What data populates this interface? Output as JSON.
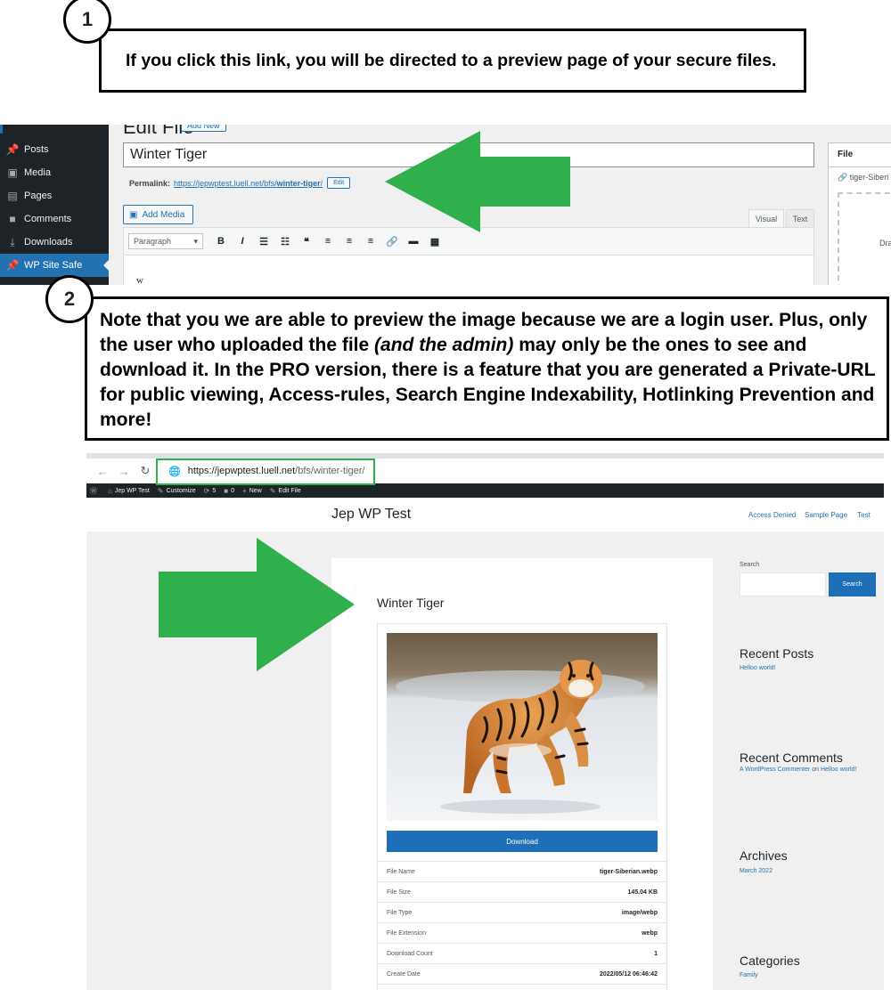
{
  "callout1": {
    "number": "1",
    "text": "If you click this link, you will be directed to a preview page of your secure files."
  },
  "admin": {
    "sidebar": [
      {
        "label": "Posts",
        "icon": "pin-icon"
      },
      {
        "label": "Media",
        "icon": "media-icon"
      },
      {
        "label": "Pages",
        "icon": "pages-icon"
      },
      {
        "label": "Comments",
        "icon": "comment-icon"
      },
      {
        "label": "Downloads",
        "icon": "download-icon"
      },
      {
        "label": "WP Site Safe",
        "icon": "pin-icon",
        "active": true
      }
    ],
    "heading": "Edit File",
    "add_new": "Add New",
    "title_value": "Winter Tiger",
    "permalink_label": "Permalink:",
    "permalink_base": "https://jepwptest.luell.net/bfs/",
    "permalink_slug": "winter-tiger",
    "permalink_trailing": "/",
    "permalink_edit": "Edit",
    "add_media": "Add Media",
    "tab_visual": "Visual",
    "tab_text": "Text",
    "format_select": "Paragraph",
    "editor_text": "w",
    "file_box_title": "File",
    "file_box_name": "tiger-Siberi",
    "file_box_drop": "Dra"
  },
  "callout2": {
    "number": "2",
    "text_before": "Note that you we are able to preview the image because we are a login user. Plus, only the user who uploaded the file ",
    "text_italic": "(and the admin)",
    "text_after": " may only be the ones to see and download it. In the PRO version, there is a feature that you are generated a Private-URL for public viewing, Access-rules, Search Engine Indexability, Hotlinking Prevention and more!"
  },
  "browser": {
    "url_domain": "https://jepwptest.luell.net",
    "url_path": "/bfs/winter-tiger/",
    "adminbar": [
      {
        "label": "",
        "icon": "wordpress-icon"
      },
      {
        "label": "Jep WP Test",
        "icon": "home-icon"
      },
      {
        "label": "Customize",
        "icon": "brush-icon"
      },
      {
        "label": "5",
        "icon": "updates-icon"
      },
      {
        "label": "0",
        "icon": "comment-icon"
      },
      {
        "label": "New",
        "icon": "plus-icon"
      },
      {
        "label": "Edit File",
        "icon": "pencil-icon"
      }
    ],
    "site_title": "Jep WP Test",
    "menu": [
      "Access Denied",
      "Sample Page",
      "Test"
    ],
    "post_title": "Winter Tiger",
    "download_label": "Download",
    "file_info": [
      {
        "key": "File Name",
        "value": "tiger-Siberian.webp"
      },
      {
        "key": "File Size",
        "value": "145.04 KB"
      },
      {
        "key": "File Type",
        "value": "image/webp"
      },
      {
        "key": "File Extension",
        "value": "webp"
      },
      {
        "key": "Download Count",
        "value": "1"
      },
      {
        "key": "Create Date",
        "value": "2022/05/12 06:46:42"
      }
    ],
    "widgets": {
      "search_label": "Search",
      "search_button": "Search",
      "recent_posts_title": "Recent Posts",
      "recent_post_link": "Helloo world!",
      "recent_comments_title": "Recent Comments",
      "comment_author": "A WordPress Commenter",
      "comment_on": "on",
      "comment_post": "Helloo world!",
      "archives_title": "Archives",
      "archive_link": "March 2022",
      "categories_title": "Categories",
      "category_link": "Family"
    }
  },
  "colors": {
    "arrow_green": "#2fb04c",
    "wp_blue": "#2271b1",
    "button_blue": "#1e6fb7",
    "admin_dark": "#1d2327"
  }
}
